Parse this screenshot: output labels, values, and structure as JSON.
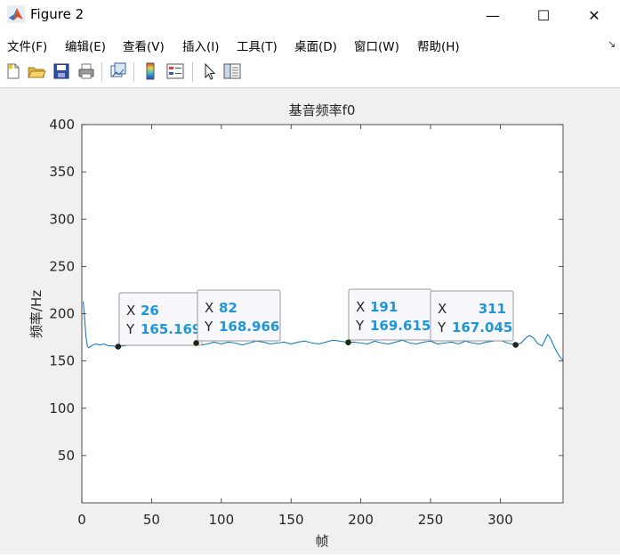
{
  "window": {
    "title": "Figure 2",
    "minimize_glyph": "—",
    "maximize_glyph": "☐",
    "close_glyph": "✕"
  },
  "menu": [
    {
      "label": "文件(F)"
    },
    {
      "label": "编辑(E)"
    },
    {
      "label": "查看(V)"
    },
    {
      "label": "插入(I)"
    },
    {
      "label": "工具(T)"
    },
    {
      "label": "桌面(D)"
    },
    {
      "label": "窗口(W)"
    },
    {
      "label": "帮助(H)"
    }
  ],
  "toolbar_icons": [
    "new-figure-icon",
    "open-file-icon",
    "save-icon",
    "print-icon",
    "link-plot-icon",
    "colorbar-icon",
    "legend-icon",
    "pointer-icon",
    "property-editor-icon"
  ],
  "colors": {
    "line": "#0072bd",
    "datatip_value": "#1e96dc",
    "datatip_bg": "#f8f8fc",
    "axes_bg": "#ffffff"
  },
  "chart_data": {
    "type": "line",
    "title": "基音频率f0",
    "xlabel": "帧",
    "ylabel": "频率/Hz",
    "xlim": [
      0,
      345
    ],
    "ylim": [
      0,
      400
    ],
    "xticks": [
      0,
      50,
      100,
      150,
      200,
      250,
      300
    ],
    "yticks": [
      50,
      100,
      150,
      200,
      250,
      300,
      350,
      400
    ],
    "grid": false,
    "series": [
      {
        "x": [
          1,
          2,
          3,
          4,
          5,
          6,
          8,
          10,
          13,
          16,
          19,
          22,
          26,
          30,
          35,
          40,
          45,
          50,
          55,
          60,
          65,
          70,
          75,
          80,
          82,
          86,
          90,
          95,
          100,
          105,
          110,
          115,
          120,
          125,
          130,
          135,
          140,
          145,
          150,
          155,
          160,
          165,
          170,
          175,
          180,
          185,
          191,
          195,
          200,
          205,
          210,
          215,
          220,
          225,
          230,
          235,
          240,
          245,
          250,
          255,
          260,
          265,
          270,
          275,
          280,
          285,
          290,
          295,
          300,
          305,
          311,
          315,
          318,
          321,
          324,
          327,
          330,
          332,
          334,
          336,
          338,
          340,
          342,
          344,
          345
        ],
        "y": [
          213,
          195,
          175,
          166,
          164,
          165,
          167,
          168,
          167,
          168,
          166,
          166,
          165.169,
          166,
          167,
          169,
          170,
          168,
          169,
          171,
          170,
          169,
          170,
          168,
          168.966,
          167,
          168,
          170,
          168,
          170,
          169,
          167,
          169,
          171,
          170,
          168,
          169,
          170,
          168,
          170,
          171,
          169,
          168,
          170,
          172,
          171,
          169.615,
          170,
          169,
          168,
          171,
          169,
          168,
          170,
          172,
          169,
          168,
          170,
          171,
          168,
          169,
          170,
          168,
          171,
          169,
          168,
          170,
          171,
          172,
          169,
          167.045,
          169,
          174,
          177,
          174,
          168,
          166,
          172,
          178,
          174,
          167,
          161,
          156,
          152,
          151
        ]
      }
    ],
    "datatips": [
      {
        "x": "26",
        "y": "165.169",
        "xv": 26,
        "yv": 165.169
      },
      {
        "x": "82",
        "y": "168.966",
        "xv": 82,
        "yv": 168.966
      },
      {
        "x": "191",
        "y": "169.615",
        "xv": 191,
        "yv": 169.615
      },
      {
        "x": "311",
        "y": "167.045",
        "xv": 311,
        "yv": 167.045
      }
    ],
    "datatip_labels": {
      "x": "X",
      "y": "Y"
    }
  }
}
